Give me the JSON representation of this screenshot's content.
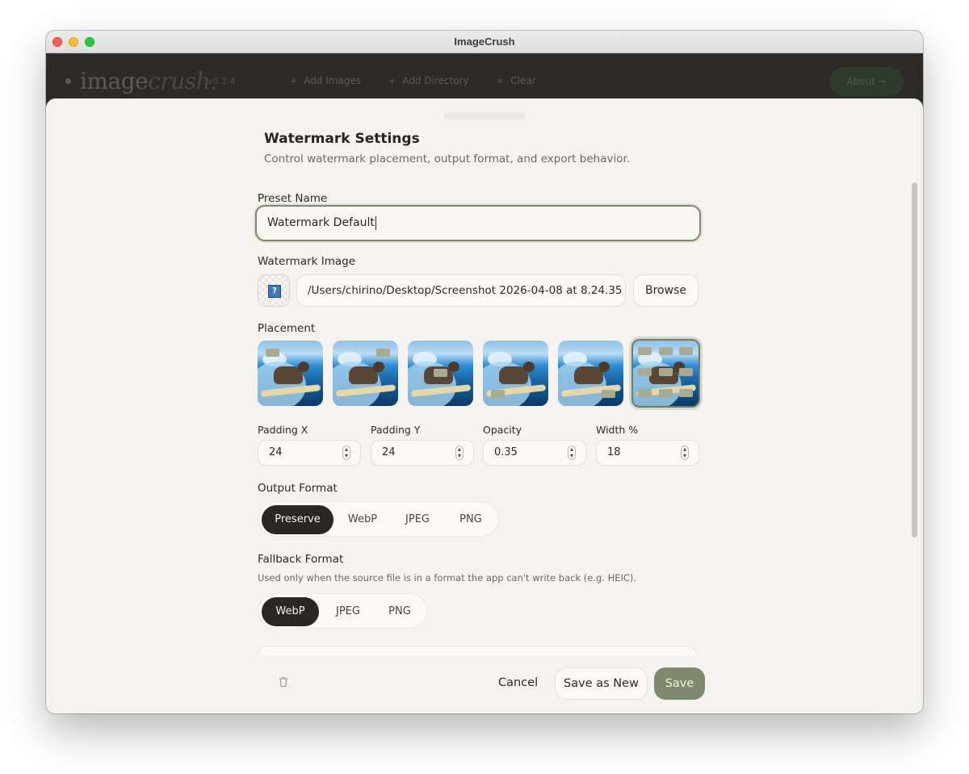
{
  "window": {
    "title": "ImageCrush"
  },
  "appbar": {
    "logo_plain": "image",
    "logo_italic": "crush.",
    "version": "v0.1.4",
    "add_images": "Add Images",
    "add_directory": "Add Directory",
    "clear": "Clear",
    "about": "About"
  },
  "sheet": {
    "title": "Watermark Settings",
    "subtitle": "Control watermark placement, output format, and export behavior.",
    "preset_name_label": "Preset Name",
    "preset_name_value": "Watermark Default",
    "watermark_image_label": "Watermark Image",
    "watermark_path": "/Users/chirino/Desktop/Screenshot 2026-04-08 at 8.24.35",
    "browse": "Browse",
    "placement_label": "Placement",
    "placement_options": [
      "top-left",
      "top-right",
      "center",
      "bottom-left",
      "bottom-right",
      "all"
    ],
    "placement_selected": "all",
    "padding_x_label": "Padding X",
    "padding_x": "24",
    "padding_y_label": "Padding Y",
    "padding_y": "24",
    "opacity_label": "Opacity",
    "opacity": "0.35",
    "width_label": "Width %",
    "width_pct": "18",
    "output_format_label": "Output Format",
    "output_formats": [
      "Preserve",
      "WebP",
      "JPEG",
      "PNG"
    ],
    "output_selected": "Preserve",
    "fallback_format_label": "Fallback Format",
    "fallback_hint": "Used only when the source file is in a format the app can't write back (e.g. HEIC).",
    "fallback_formats": [
      "WebP",
      "JPEG",
      "PNG"
    ],
    "fallback_selected": "WebP"
  },
  "footer": {
    "cancel": "Cancel",
    "save_as_new": "Save as New",
    "save": "Save"
  },
  "colors": {
    "accent": "#7d8a6b",
    "sheet_bg": "#f5f3ef",
    "segment_active": "#2a2622"
  },
  "icons": {
    "watermark_preview": "question-mark-icon",
    "delete": "trash-icon",
    "stepper": "up-down-chevron-icon"
  }
}
